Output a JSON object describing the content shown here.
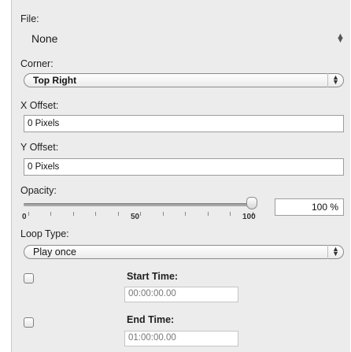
{
  "file": {
    "label": "File:",
    "value": "None"
  },
  "corner": {
    "label": "Corner:",
    "value": "Top Right"
  },
  "x_offset": {
    "label": "X Offset:",
    "value": "0 Pixels"
  },
  "y_offset": {
    "label": "Y Offset:",
    "value": "0 Pixels"
  },
  "opacity": {
    "label": "Opacity:",
    "value_text": "100 %",
    "value_percent": 100,
    "tick_labels": [
      "0",
      "50",
      "100"
    ]
  },
  "loop_type": {
    "label": "Loop Type:",
    "value": "Play once"
  },
  "start_time": {
    "label": "Start Time:",
    "value": "00:00:00.00",
    "checked": false
  },
  "end_time": {
    "label": "End Time:",
    "value": "01:00:00.00",
    "checked": false
  }
}
